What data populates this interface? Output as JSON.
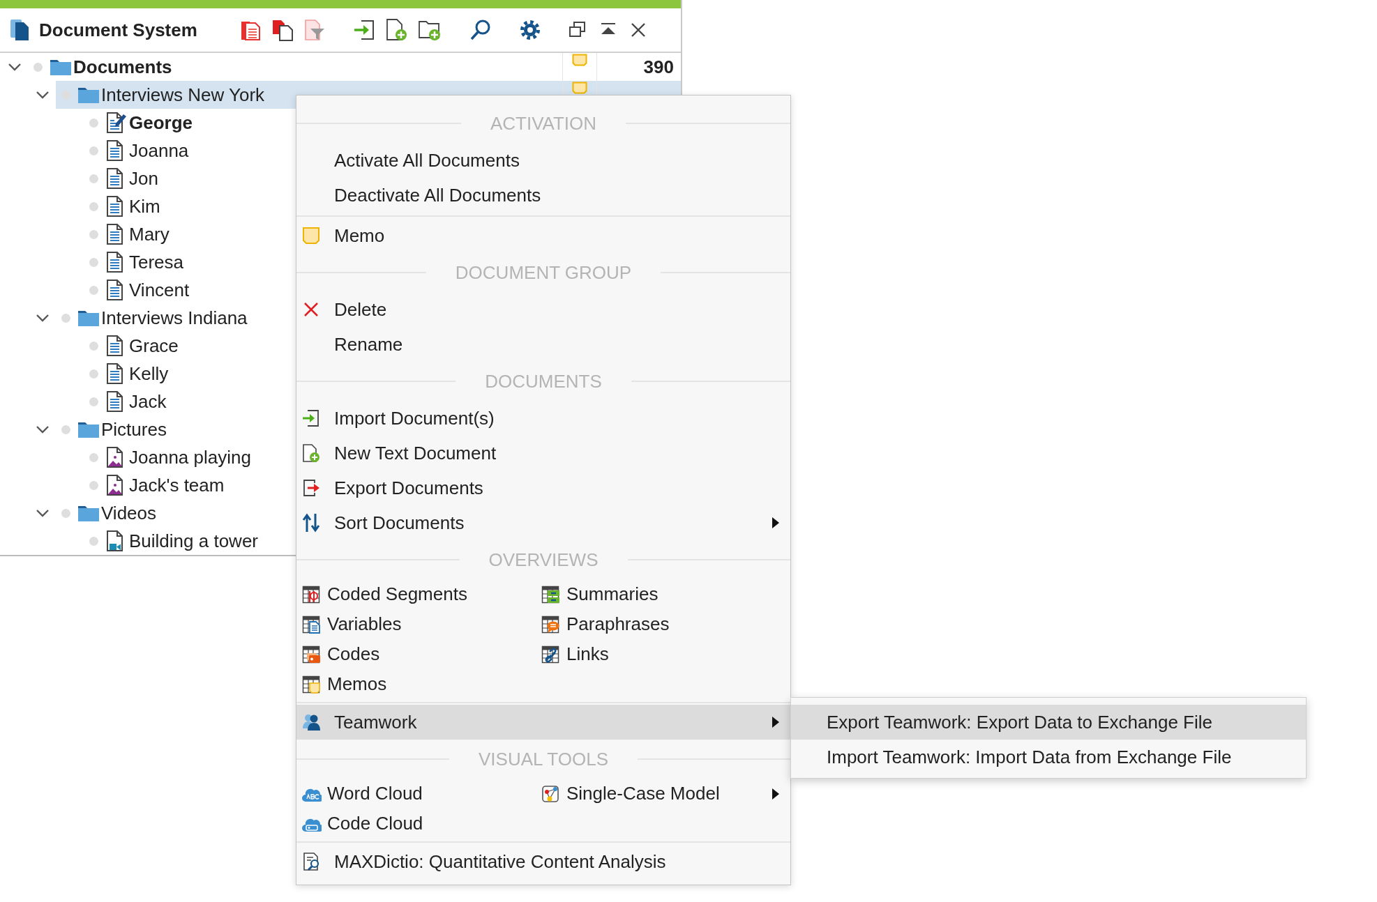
{
  "window": {
    "title": "Document System"
  },
  "tree": [
    {
      "label": "Documents",
      "kind": "root",
      "expanded": true,
      "selected": false,
      "active": false,
      "memo": true,
      "count": "390",
      "children": [
        {
          "label": "Interviews New York",
          "kind": "folder",
          "expanded": true,
          "selected": true,
          "active": false,
          "memo": true,
          "children": [
            {
              "label": "George",
              "kind": "text",
              "open": true,
              "selected": false,
              "active": false,
              "memo": false
            },
            {
              "label": "Joanna",
              "kind": "text",
              "open": false,
              "selected": false,
              "active": false,
              "memo": false
            },
            {
              "label": "Jon",
              "kind": "text",
              "open": false,
              "selected": false,
              "active": false,
              "memo": false
            },
            {
              "label": "Kim",
              "kind": "text",
              "open": false,
              "selected": false,
              "active": false,
              "memo": false
            },
            {
              "label": "Mary",
              "kind": "text",
              "open": false,
              "selected": false,
              "active": false,
              "memo": false
            },
            {
              "label": "Teresa",
              "kind": "text",
              "open": false,
              "selected": false,
              "active": false,
              "memo": false
            },
            {
              "label": "Vincent",
              "kind": "text",
              "open": false,
              "selected": false,
              "active": false,
              "memo": false
            }
          ]
        },
        {
          "label": "Interviews Indiana",
          "kind": "folder",
          "expanded": true,
          "selected": false,
          "active": false,
          "memo": false,
          "children": [
            {
              "label": "Grace",
              "kind": "text",
              "open": false,
              "selected": false,
              "active": false,
              "memo": false
            },
            {
              "label": "Kelly",
              "kind": "text",
              "open": false,
              "selected": false,
              "active": false,
              "memo": false
            },
            {
              "label": "Jack",
              "kind": "text",
              "open": false,
              "selected": false,
              "active": false,
              "memo": false
            }
          ]
        },
        {
          "label": "Pictures",
          "kind": "folder",
          "expanded": true,
          "selected": false,
          "active": false,
          "memo": false,
          "children": [
            {
              "label": "Joanna playing",
              "kind": "picture",
              "selected": false,
              "active": false,
              "memo": false
            },
            {
              "label": "Jack's team",
              "kind": "picture",
              "selected": false,
              "active": false,
              "memo": false
            }
          ]
        },
        {
          "label": "Videos",
          "kind": "folder",
          "expanded": true,
          "selected": false,
          "active": false,
          "memo": false,
          "children": [
            {
              "label": "Building a tower",
              "kind": "video",
              "selected": false,
              "active": false,
              "memo": false
            }
          ]
        }
      ]
    }
  ],
  "context_menu": {
    "sections": [
      {
        "header": "ACTIVATION",
        "kind": "list",
        "items": [
          {
            "label": "Activate All Documents",
            "selected": false,
            "submenu": false
          },
          {
            "label": "Deactivate All Documents",
            "selected": false,
            "submenu": false
          }
        ]
      },
      {
        "kind": "list",
        "items": [
          {
            "label": "Memo",
            "selected": false,
            "submenu": false
          }
        ]
      },
      {
        "header": "DOCUMENT GROUP",
        "kind": "list",
        "items": [
          {
            "label": "Delete",
            "selected": false,
            "submenu": false
          },
          {
            "label": "Rename",
            "selected": false,
            "submenu": false
          }
        ]
      },
      {
        "header": "DOCUMENTS",
        "kind": "list",
        "items": [
          {
            "label": "Import Document(s)",
            "selected": false,
            "submenu": false
          },
          {
            "label": "New Text Document",
            "selected": false,
            "submenu": false
          },
          {
            "label": "Export Documents",
            "selected": false,
            "submenu": false
          },
          {
            "label": "Sort Documents",
            "selected": false,
            "submenu": true
          }
        ]
      },
      {
        "header": "OVERVIEWS",
        "kind": "grid",
        "items": [
          {
            "label": "Coded Segments",
            "selected": false,
            "submenu": false
          },
          {
            "label": "Summaries",
            "selected": false,
            "submenu": false
          },
          {
            "label": "Variables",
            "selected": false,
            "submenu": false
          },
          {
            "label": "Paraphrases",
            "selected": false,
            "submenu": false
          },
          {
            "label": "Codes",
            "selected": false,
            "submenu": false
          },
          {
            "label": "Links",
            "selected": false,
            "submenu": false
          },
          {
            "label": "Memos",
            "selected": false,
            "submenu": false
          }
        ]
      },
      {
        "kind": "list",
        "items": [
          {
            "label": "Teamwork",
            "selected": true,
            "submenu": true
          }
        ]
      },
      {
        "header": "VISUAL TOOLS",
        "kind": "grid",
        "items": [
          {
            "label": "Word Cloud",
            "selected": false,
            "submenu": false
          },
          {
            "label": "Single-Case Model",
            "selected": false,
            "submenu": true
          },
          {
            "label": "Code Cloud",
            "selected": false,
            "submenu": false
          }
        ]
      },
      {
        "kind": "list",
        "items": [
          {
            "label": "MAXDictio: Quantitative Content Analysis",
            "selected": false,
            "submenu": false
          }
        ]
      }
    ]
  },
  "submenu": {
    "items": [
      {
        "label": "Export Teamwork: Export Data to Exchange File",
        "selected": true
      },
      {
        "label": "Import Teamwork: Import Data from Exchange File",
        "selected": false
      }
    ]
  }
}
